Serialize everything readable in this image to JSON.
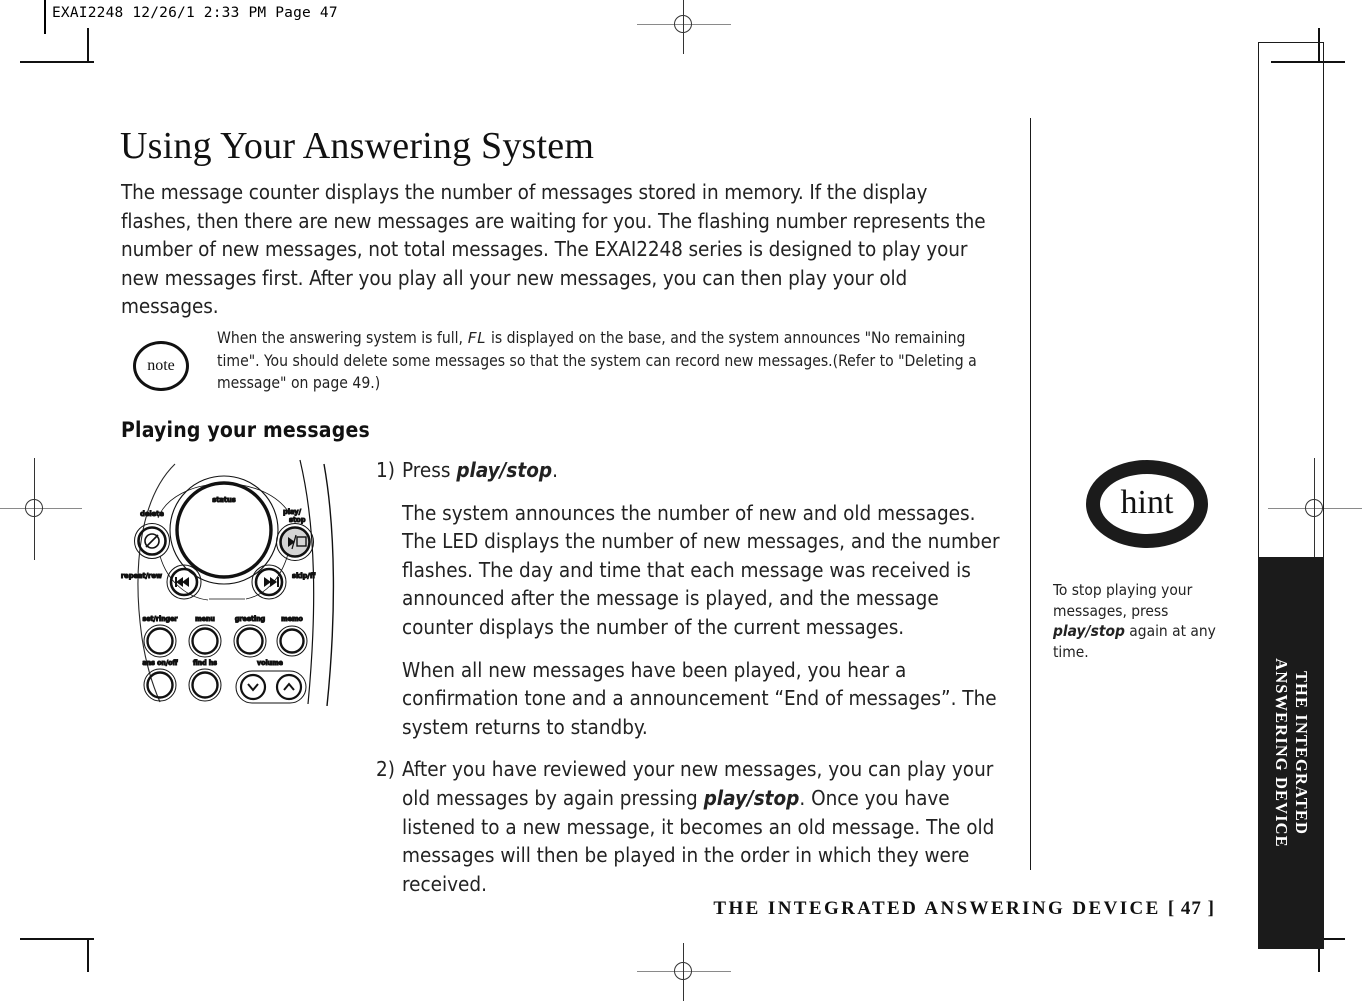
{
  "printer_slug": "EXAI2248  12/26/1 2:33 PM  Page 47",
  "title": "Using Your Answering System",
  "intro": "The message counter displays the number of messages stored in memory. If the display flashes, then there are new messages are waiting for you. The flashing number represents the number of new messages, not total messages. The EXAI2248 series is designed to play your new messages first. After you play all your new messages, you can then play your old messages.",
  "note": {
    "badge_label": "note",
    "text_before": "When the answering system is full,",
    "lcd_value": "FL",
    "text_after": "is displayed on the base, and the system announces \"No remaining time\". You should delete some messages so that the system can record new messages.(Refer to \"Deleting a message\" on page 49.)"
  },
  "subheading": "Playing your messages",
  "steps": [
    {
      "number": "1)",
      "lead_before": "Press ",
      "lead_bold": "play/stop",
      "lead_after": ".",
      "paragraphs": [
        "The system announces the number of new and old messages. The LED displays the number of new messages, and the number flashes. The day and time that each message was received is announced after the message is played, and the message counter displays the number of the current messages.",
        "When all new messages have been played, you hear a confirmation tone and a announcement “End of messages”. The system returns to standby."
      ]
    },
    {
      "number": "2)",
      "para_before": "After you have reviewed your new messages, you can play your old messages by again pressing ",
      "para_bold": "play/stop",
      "para_after": ". Once you have listened to a new message, it becomes an old message. The old messages will then be played in the order in which they were received."
    }
  ],
  "hint": {
    "badge_label": "hint",
    "text_before": "To stop playing your messages, press ",
    "text_bold": "play/stop",
    "text_after": " again at any time."
  },
  "side_tab": {
    "line1": "THE INTEGRATED",
    "line2": "ANSWERING DEVICE"
  },
  "footer": {
    "running_head": "THE INTEGRATED ANSWERING DEVICE",
    "page_number": "[ 47 ]"
  },
  "device_diagram": {
    "status_label": "status",
    "buttons": [
      {
        "name": "delete",
        "label": "delete",
        "glyph": "Ø"
      },
      {
        "name": "play-stop",
        "label_line1": "play/",
        "label_line2": "stop",
        "glyph": "▷/□"
      },
      {
        "name": "repeat-rew",
        "label": "repeat/rew",
        "glyph": "⏮"
      },
      {
        "name": "skip-ff",
        "label": "skip/ff",
        "glyph": "⏭"
      },
      {
        "name": "set-ringer",
        "label": "set/ringer"
      },
      {
        "name": "menu",
        "label": "menu"
      },
      {
        "name": "greeting",
        "label": "greeting"
      },
      {
        "name": "memo",
        "label": "memo"
      },
      {
        "name": "ans-on-off",
        "label": "ans on/off"
      },
      {
        "name": "find-hs",
        "label": "find hs"
      },
      {
        "name": "volume-down",
        "label": "volume",
        "glyph": "∨"
      },
      {
        "name": "volume-up",
        "glyph": "∧"
      }
    ]
  },
  "colors": {
    "ink": "#1a1a1a",
    "tab_bg": "#1b1b1b",
    "play_button_fill": "#d4d4d4"
  }
}
